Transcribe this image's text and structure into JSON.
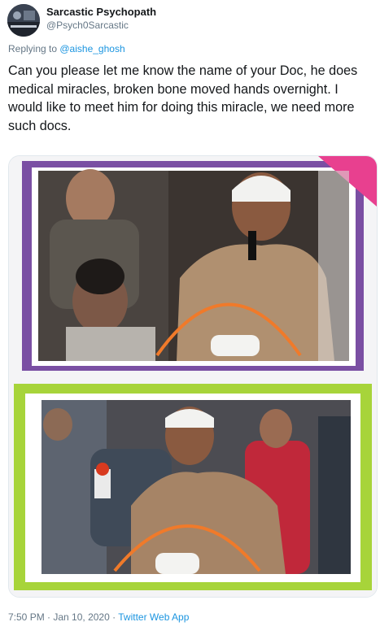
{
  "author": {
    "name": "Sarcastic Psychopath",
    "handle": "@Psych0Sarcastic",
    "avatar_icon": "avatar-photo-icon"
  },
  "reply": {
    "prefix": "Replying to ",
    "mention": "@aishe_ghosh"
  },
  "tweet": {
    "text": "Can you please let me know the name of your Doc, he does medical miracles, broken bone moved hands overnight. I would like to meet him for doing this miracle, we need more such docs."
  },
  "media": {
    "description_icon": "photo-collage-icon",
    "colors": {
      "top_frame": "#7a4fa3",
      "bottom_frame": "#a7d43a",
      "arc": "#f07a2a",
      "corner": "#e8408f"
    }
  },
  "footer": {
    "time": "7:50 PM",
    "separator": " · ",
    "date": "Jan 10, 2020",
    "app": "Twitter Web App"
  }
}
